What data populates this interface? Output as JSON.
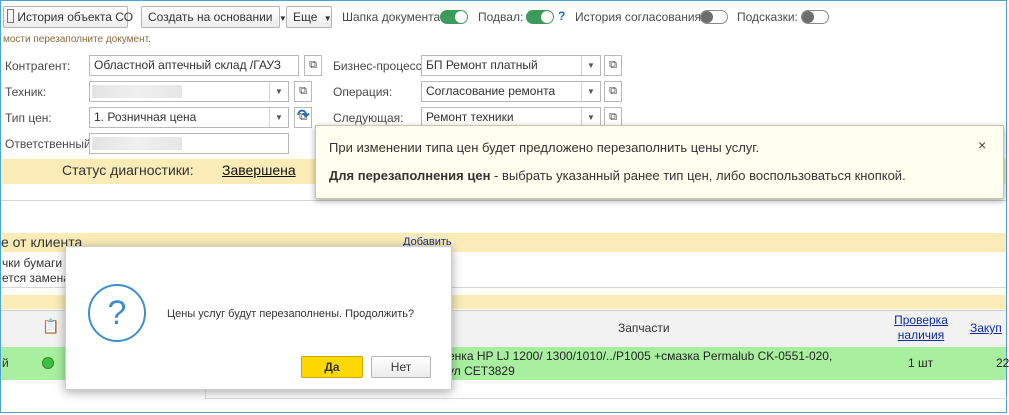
{
  "toolbar": {
    "history_button": "История объекта СО",
    "create_based_button": "Создать на основании",
    "more_button": "Еще",
    "doc_header_label": "Шапка документа:",
    "footer_label": "Подвал:",
    "help_mark": "?",
    "approval_history_label": "История согласования:",
    "hints_label": "Подсказки:"
  },
  "hint_text": "мости перезаполните документ.",
  "form": {
    "counterparty_label": "Контрагент:",
    "counterparty_value": "Областной аптечный склад /ГАУЗ",
    "technician_label": "Техник:",
    "price_type_label": "Тип цен:",
    "price_type_value": "1. Розничная цена",
    "responsible_label": "Ответственный:",
    "business_process_label": "Бизнес-процесс:",
    "business_process_value": "БП Ремонт платный",
    "operation_label": "Операция:",
    "operation_value": "Согласование ремонта",
    "next_label": "Следующая:",
    "next_value": "Ремонт техники"
  },
  "status": {
    "label": "Статус диагностики:",
    "value": "Завершена"
  },
  "tooltip": {
    "line1": "При изменении типа цен будет предложено перезаполнить цены услуг.",
    "line2_bold": "Для перезаполнения цен",
    "line2_rest": " - выбрать указанный ранее тип цен, либо воспользоваться кнопкой.",
    "close": "×"
  },
  "client_section": {
    "title": "е от клиента",
    "add_link": "Добавить",
    "row1": "чки бумаги",
    "row2": "ется замена"
  },
  "table": {
    "col_parts": "Запчасти",
    "col_check": "Проверка наличия",
    "col_purchase": "Закуп",
    "row_left": "й",
    "row_parts": "енка HP LJ 1200/ 1300/1010/../P1005 +смазка Permalub CK-0551-020,\nул CET3829",
    "row_qty": "1 шт",
    "row_purchase": "22"
  },
  "dialog": {
    "message": "Цены услуг будут перезаполнены. Продолжить?",
    "yes": "Да",
    "no": "Нет",
    "icon": "question-icon"
  },
  "colors": {
    "accent_green": "#3d9a5a",
    "band_yellow": "#fbecb7",
    "row_green": "#a8f0a0",
    "yes_button": "#ffd800"
  }
}
